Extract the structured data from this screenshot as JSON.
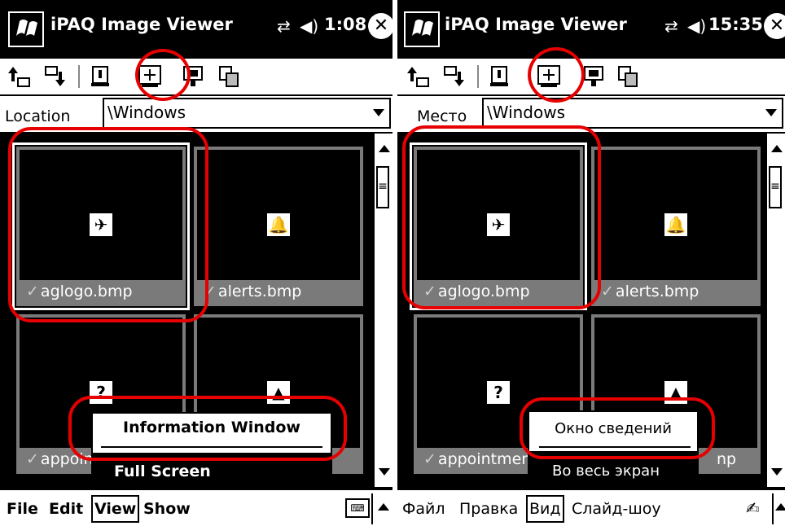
{
  "colors": {
    "highlight": "#e60000",
    "thumb_border": "#7a7a7a"
  },
  "panels": [
    {
      "title": "iPAQ Image Viewer",
      "time": "1:08",
      "location_label": "Location",
      "location_value": "\\Windows",
      "thumbnails": [
        {
          "name": "aglogo.bmp",
          "checked": true,
          "icon": "aglogo-icon"
        },
        {
          "name": "alerts.bmp",
          "checked": true,
          "icon": "bell-icon"
        },
        {
          "name": "appointm",
          "checked": true,
          "icon": "puzzle-icon"
        },
        {
          "name": "",
          "checked": false,
          "icon": "up-arrow-icon"
        }
      ],
      "menu": [
        "File",
        "Edit",
        "View",
        "Show"
      ],
      "active_menu": "View",
      "popup": {
        "item1": "Information Window",
        "item2": "Full Screen"
      }
    },
    {
      "title": "iPAQ Image Viewer",
      "time": "15:35",
      "location_label": "Место",
      "location_value": "\\Windows",
      "thumbnails": [
        {
          "name": "aglogo.bmp",
          "checked": true,
          "icon": "aglogo-icon"
        },
        {
          "name": "alerts.bmp",
          "checked": true,
          "icon": "bell-icon"
        },
        {
          "name": "appointmen",
          "checked": true,
          "icon": "puzzle-icon"
        },
        {
          "name": "np",
          "checked": false,
          "icon": "up-arrow-icon"
        }
      ],
      "menu": [
        "Файл",
        "Правка",
        "Вид",
        "Слайд-шоу"
      ],
      "active_menu": "Вид",
      "popup": {
        "item1": "Окно сведений",
        "item2": "Во весь экран"
      }
    }
  ]
}
